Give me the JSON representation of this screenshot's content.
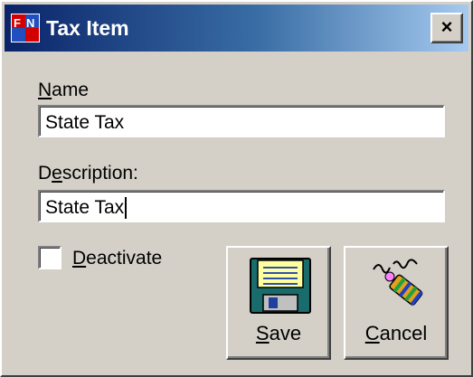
{
  "window": {
    "title": "Tax Item",
    "app_icon": "fn-app-icon",
    "close_glyph": "×"
  },
  "form": {
    "name_label_ul": "N",
    "name_label_rest": "ame",
    "name_value": "State Tax",
    "description_label_pre": "D",
    "description_label_ul": "e",
    "description_label_rest": "scription:",
    "description_value": "State Tax",
    "deactivate_label_ul": "D",
    "deactivate_label_rest": "eactivate",
    "deactivate_checked": false
  },
  "buttons": {
    "save_ul": "S",
    "save_rest": "ave",
    "save_icon": "floppy-disk-icon",
    "cancel_ul": "C",
    "cancel_rest": "ancel",
    "cancel_icon": "firecracker-icon"
  },
  "colors": {
    "dialog_face": "#d4d0c8",
    "titlebar_start": "#0a246a",
    "titlebar_end": "#a6caf0"
  }
}
